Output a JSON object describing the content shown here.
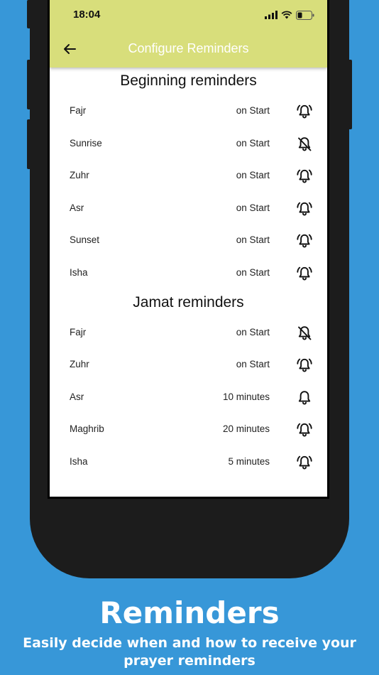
{
  "status": {
    "time": "18:04"
  },
  "appbar": {
    "title": "Configure Reminders"
  },
  "sections": [
    {
      "title": "Beginning reminders",
      "rows": [
        {
          "name": "Fajr",
          "when": "on Start",
          "icon": "bell-ringing-icon"
        },
        {
          "name": "Sunrise",
          "when": "on Start",
          "icon": "bell-off-icon"
        },
        {
          "name": "Zuhr",
          "when": "on Start",
          "icon": "bell-ringing-icon"
        },
        {
          "name": "Asr",
          "when": "on Start",
          "icon": "bell-ringing-icon"
        },
        {
          "name": "Sunset",
          "when": "on Start",
          "icon": "bell-ringing-icon"
        },
        {
          "name": "Isha",
          "when": "on Start",
          "icon": "bell-ringing-icon"
        }
      ]
    },
    {
      "title": "Jamat reminders",
      "rows": [
        {
          "name": "Fajr",
          "when": "on Start",
          "icon": "bell-off-icon"
        },
        {
          "name": "Zuhr",
          "when": "on Start",
          "icon": "bell-ringing-icon"
        },
        {
          "name": "Asr",
          "when": "10 minutes",
          "icon": "bell-icon"
        },
        {
          "name": "Maghrib",
          "when": "20 minutes",
          "icon": "bell-ringing-icon"
        },
        {
          "name": "Isha",
          "when": "5 minutes",
          "icon": "bell-ringing-icon"
        }
      ]
    }
  ],
  "promo": {
    "title": "Reminders",
    "subtitle_line1": "Easily decide when and how to receive your",
    "subtitle_line2": "prayer reminders"
  },
  "colors": {
    "background": "#3797d8",
    "appbar": "#d8de7b",
    "phone": "#1c1c1c"
  }
}
